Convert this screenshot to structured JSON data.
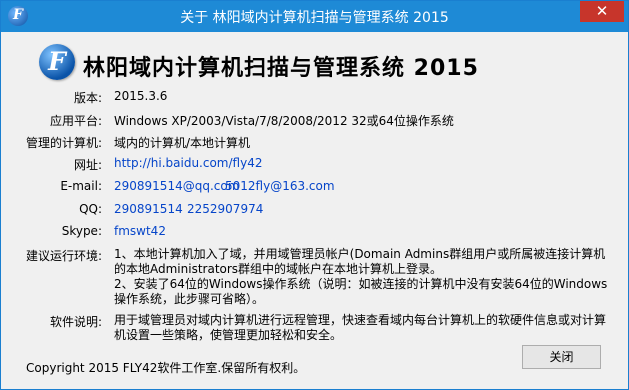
{
  "window": {
    "title": "关于 林阳域内计算机扫描与管理系统 2015",
    "close_glyph": "✕"
  },
  "header": {
    "logo_letter": "F",
    "title": "林阳域内计算机扫描与管理系统  2015"
  },
  "info": {
    "version_label": "版本:",
    "version": "2015.3.6",
    "platform_label": "应用平台:",
    "platform": "Windows XP/2003/Vista/7/8/2008/2012 32或64位操作系统",
    "managed_label": "管理的计算机:",
    "managed": "域内的计算机/本地计算机",
    "website_label": "网址:",
    "website": "http://hi.baidu.com/fly42",
    "email_label": "E-mail:",
    "email1": "290891514@qq.com",
    "email2": "5012fly@163.com",
    "qq_label": "QQ:",
    "qq1": "290891514",
    "qq2": "2252907974",
    "skype_label": "Skype:",
    "skype": "fmswt42",
    "env_label": "建议运行环境:",
    "env_1": "1、本地计算机加入了域，并用域管理员帐户(Domain Admins群组用户或所属被连接计算机的本地Administrators群组中的域帐户在本地计算机上登录。",
    "env_2": "2、安装了64位的Windows操作系统（说明：如被连接的计算机中没有安装64位的Windows操作系统，此步骤可省略）。",
    "desc_label": "软件说明:",
    "desc": "用于域管理员对域内计算机进行远程管理，快速查看域内每台计算机上的软硬件信息或对计算机设置一些策略，使管理更加轻松和安全。"
  },
  "footer": {
    "copyright": "Copyright 2015 FLY42软件工作室.保留所有权利。",
    "close_button": "关闭"
  },
  "colors": {
    "titlebar": "#1e8ad6",
    "close_red": "#c7352b",
    "link": "#0645c9"
  }
}
